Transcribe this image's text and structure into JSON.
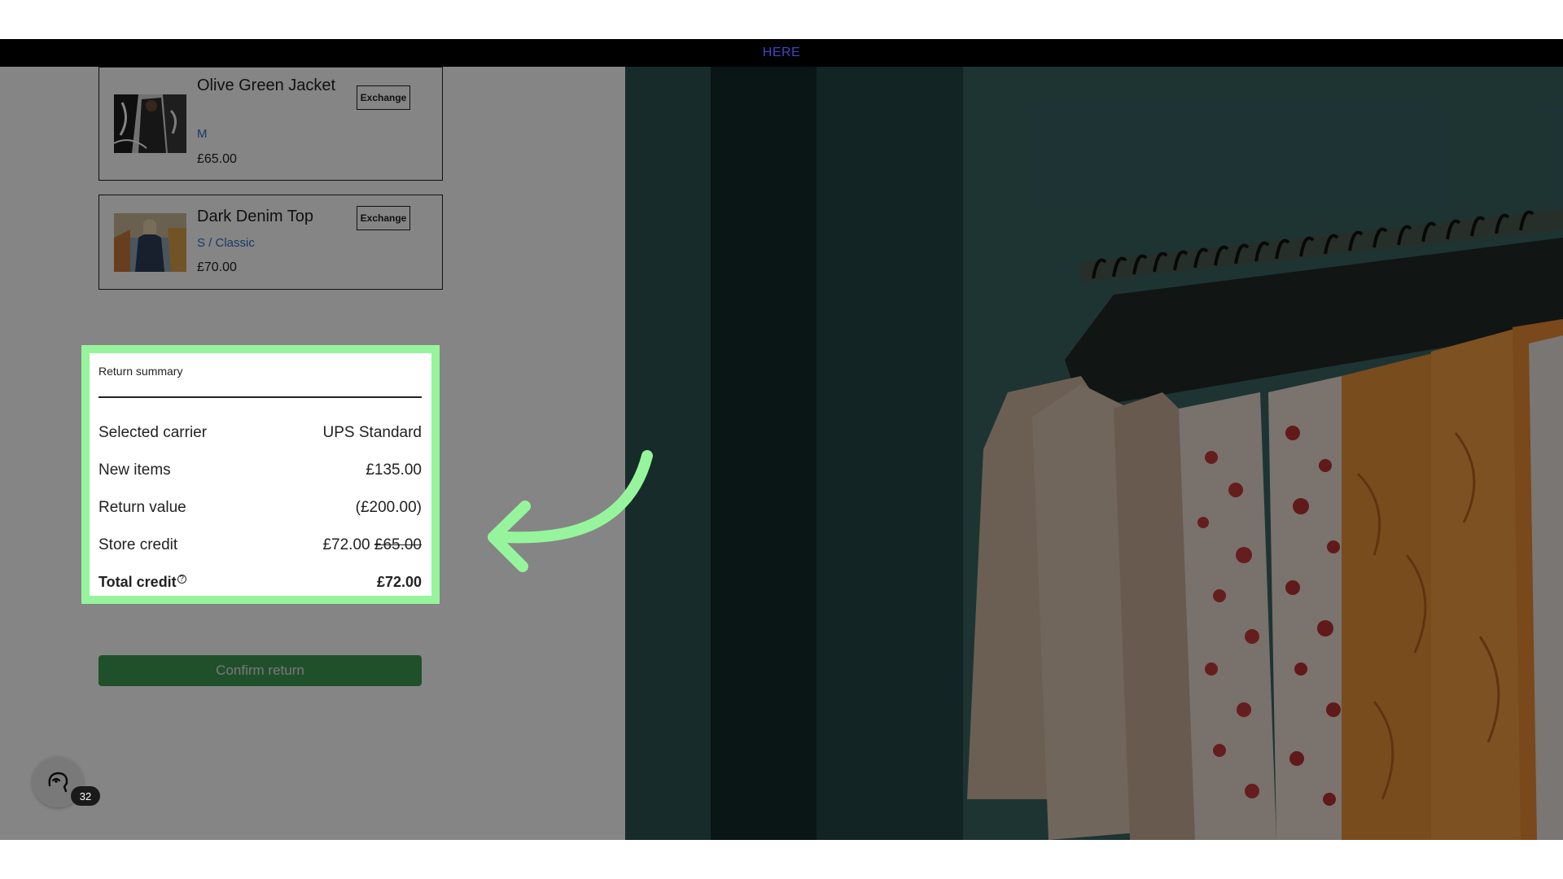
{
  "banner": {
    "link_text": "HERE"
  },
  "products": [
    {
      "name": "Olive Green Jacket",
      "variant": "M",
      "price": "£65.00",
      "action_label": "Exchange"
    },
    {
      "name": "Dark Denim Top",
      "variant": "S / Classic",
      "price": "£70.00",
      "action_label": "Exchange"
    }
  ],
  "summary": {
    "title": "Return summary",
    "rows": [
      {
        "label": "Selected carrier",
        "value": "UPS Standard"
      },
      {
        "label": "New items",
        "value": "£135.00"
      },
      {
        "label": "Return value",
        "value": "(£200.00)"
      },
      {
        "label": "Store credit",
        "value": "£72.00",
        "old_value": "£65.00"
      }
    ],
    "total": {
      "label": "Total credit",
      "value": "£72.00",
      "info_icon": "info-icon"
    }
  },
  "confirm_button": {
    "label": "Confirm return"
  },
  "widget": {
    "badge_count": "32",
    "icon": "profile-head-icon"
  },
  "colors": {
    "highlight": "#96f59c",
    "confirm": "#3f9a52",
    "variant_link": "#2f6fc4",
    "banner_link": "#3f46c7"
  }
}
